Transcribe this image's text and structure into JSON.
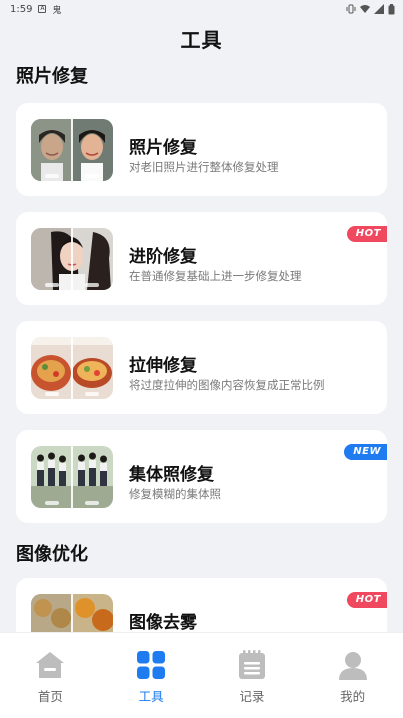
{
  "status_bar": {
    "time": "1:59",
    "app_glyph": "鬼"
  },
  "header": {
    "title": "工具"
  },
  "sections": [
    {
      "title": "照片修复"
    },
    {
      "title": "图像优化"
    }
  ],
  "cards": [
    {
      "title": "照片修复",
      "desc": "对老旧照片进行整体修复处理",
      "badge": "",
      "thumb_icon": "portrait-comparison-thumbnail"
    },
    {
      "title": "进阶修复",
      "desc": "在普通修复基础上进一步修复处理",
      "badge": "HOT",
      "thumb_icon": "woman-portrait-comparison-thumbnail"
    },
    {
      "title": "拉伸修复",
      "desc": "将过度拉伸的图像内容恢复成正常比例",
      "badge": "",
      "thumb_icon": "food-comparison-thumbnail"
    },
    {
      "title": "集体照修复",
      "desc": "修复模糊的集体照",
      "badge": "NEW",
      "thumb_icon": "group-photo-comparison-thumbnail"
    },
    {
      "title": "图像去雾",
      "desc": "",
      "badge": "HOT",
      "thumb_icon": "autumn-landscape-comparison-thumbnail"
    }
  ],
  "tabs": [
    {
      "label": "首页",
      "icon": "home-icon",
      "active": false
    },
    {
      "label": "工具",
      "icon": "grid-icon",
      "active": true
    },
    {
      "label": "记录",
      "icon": "notepad-icon",
      "active": false
    },
    {
      "label": "我的",
      "icon": "person-icon",
      "active": false
    }
  ],
  "colors": {
    "accent": "#1e7bf0",
    "hot_badge": "#f0485e",
    "new_badge": "#1e7bf0",
    "inactive_icon": "#bdbdbd",
    "background": "#f1f2f5"
  }
}
